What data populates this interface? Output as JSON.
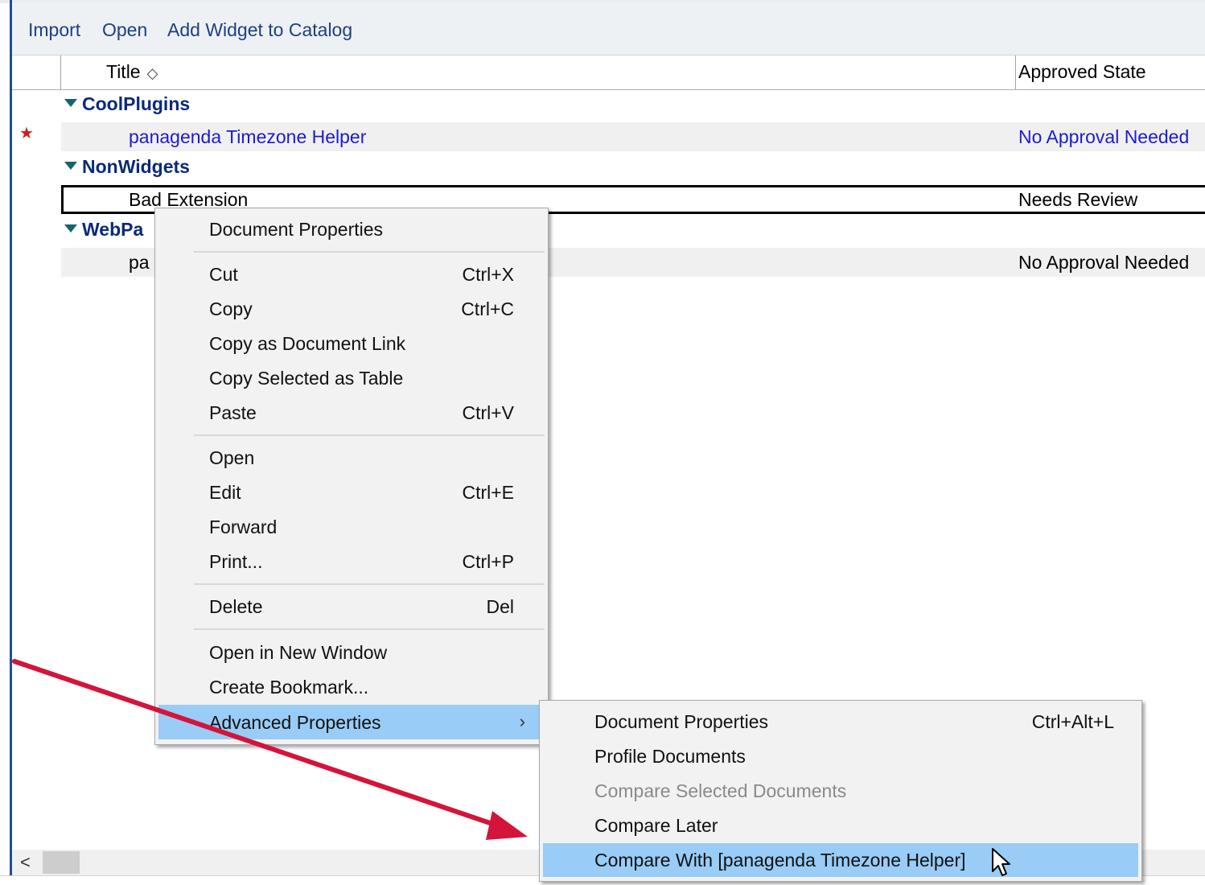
{
  "toolbar": {
    "import_label": "Import",
    "open_label": "Open",
    "add_widget_label": "Add Widget to Catalog"
  },
  "columns": {
    "title": "Title",
    "sort_icon": "◇",
    "approved_state": "Approved State"
  },
  "categories": [
    {
      "label": "CoolPlugins"
    },
    {
      "label": "NonWidgets"
    },
    {
      "label": "WebPa"
    }
  ],
  "documents": [
    {
      "title": "panagenda Timezone Helper",
      "state": "No Approval Needed",
      "unread": true
    },
    {
      "title": "Bad Extension",
      "state": "Needs Review"
    },
    {
      "title": "pa",
      "state": "No Approval Needed"
    }
  ],
  "unread_icon": "★",
  "context_menu": {
    "items": [
      {
        "label": "Document Properties",
        "shortcut": ""
      },
      {
        "label": "Cut",
        "shortcut": "Ctrl+X"
      },
      {
        "label": "Copy",
        "shortcut": "Ctrl+C"
      },
      {
        "label": "Copy as Document Link",
        "shortcut": ""
      },
      {
        "label": "Copy Selected as Table",
        "shortcut": ""
      },
      {
        "label": "Paste",
        "shortcut": "Ctrl+V"
      },
      {
        "label": "Open",
        "shortcut": ""
      },
      {
        "label": "Edit",
        "shortcut": "Ctrl+E"
      },
      {
        "label": "Forward",
        "shortcut": ""
      },
      {
        "label": "Print...",
        "shortcut": "Ctrl+P"
      },
      {
        "label": "Delete",
        "shortcut": "Del"
      },
      {
        "label": "Open in New Window",
        "shortcut": ""
      },
      {
        "label": "Create Bookmark...",
        "shortcut": ""
      },
      {
        "label": "Advanced Properties",
        "shortcut": "",
        "submenu_arrow": "›"
      }
    ]
  },
  "submenu": {
    "items": [
      {
        "label": "Document Properties",
        "shortcut": "Ctrl+Alt+L"
      },
      {
        "label": "Profile Documents",
        "shortcut": ""
      },
      {
        "label": "Compare Selected Documents",
        "shortcut": "",
        "disabled": true
      },
      {
        "label": "Compare Later",
        "shortcut": ""
      },
      {
        "label": "Compare With [panagenda Timezone Helper]",
        "shortcut": ""
      }
    ]
  },
  "scrollbar": {
    "left_arrow": "<"
  },
  "colors": {
    "annotation_arrow": "#d4143a",
    "menu_highlight": "#99ccf6",
    "category_text": "#0a2a78",
    "link_text": "#1b1bd6"
  }
}
